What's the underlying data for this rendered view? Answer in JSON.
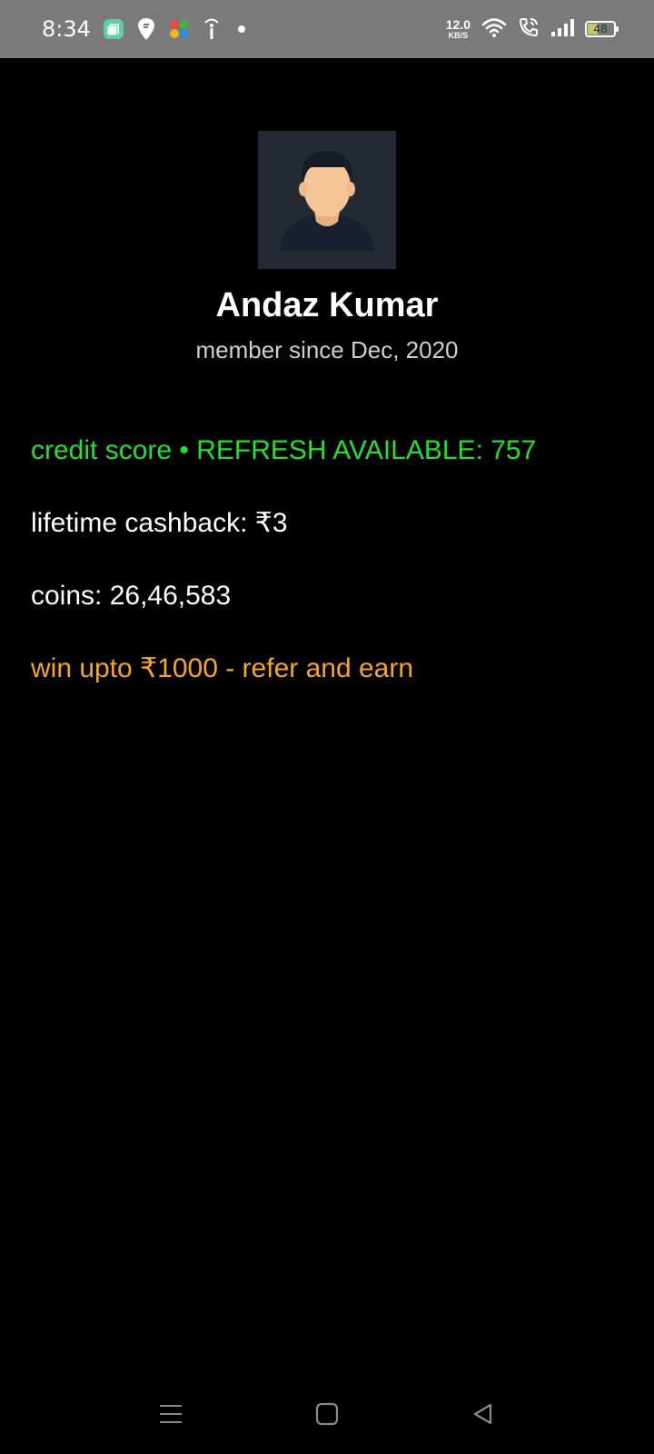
{
  "status_bar": {
    "time": "8:34",
    "net_speed_value": "12.0",
    "net_speed_unit": "KB/S",
    "battery_level": "48",
    "battery_fraction": 0.48,
    "icons": [
      "app-icon",
      "swiggy-icon",
      "pinwheel-icon",
      "info-icon",
      "wifi-icon",
      "wifi-call-icon",
      "signal-icon",
      "battery-icon"
    ]
  },
  "profile": {
    "avatar_icon": "user-avatar",
    "name": "Andaz Kumar",
    "member_since": "member since Dec, 2020"
  },
  "stats": {
    "credit_score": "credit score • REFRESH AVAILABLE: 757",
    "lifetime_cashback": "lifetime cashback: ₹3",
    "coins": "coins: 26,46,583",
    "refer": "win upto ₹1000 - refer and earn"
  },
  "colors": {
    "credit": "#22e02c",
    "refer": "#f5a623",
    "background": "#000000",
    "status_bar": "#7a7a7a"
  },
  "nav": {
    "icons": [
      "menu-icon",
      "home-icon",
      "back-icon"
    ]
  }
}
